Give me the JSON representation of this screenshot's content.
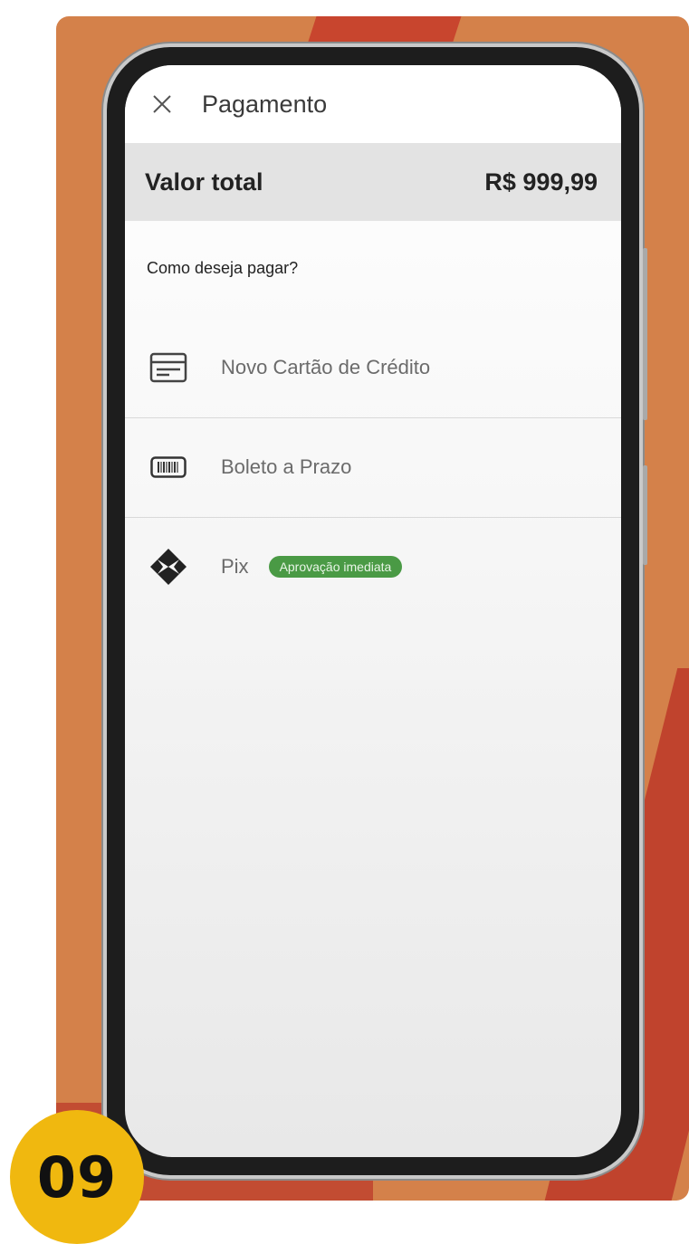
{
  "header": {
    "title": "Pagamento",
    "close_icon": "close-icon"
  },
  "total": {
    "label": "Valor total",
    "value": "R$ 999,99"
  },
  "payment": {
    "question": "Como deseja pagar?",
    "options": [
      {
        "label": "Novo Cartão de Crédito",
        "icon": "credit-card-icon"
      },
      {
        "label": "Boleto a Prazo",
        "icon": "barcode-icon"
      },
      {
        "label": "Pix",
        "icon": "pix-icon",
        "badge": "Aprovação imediata",
        "badge_color": "#4a9a45"
      }
    ]
  },
  "step_badge": {
    "number": "09",
    "color": "#f0b80f"
  }
}
